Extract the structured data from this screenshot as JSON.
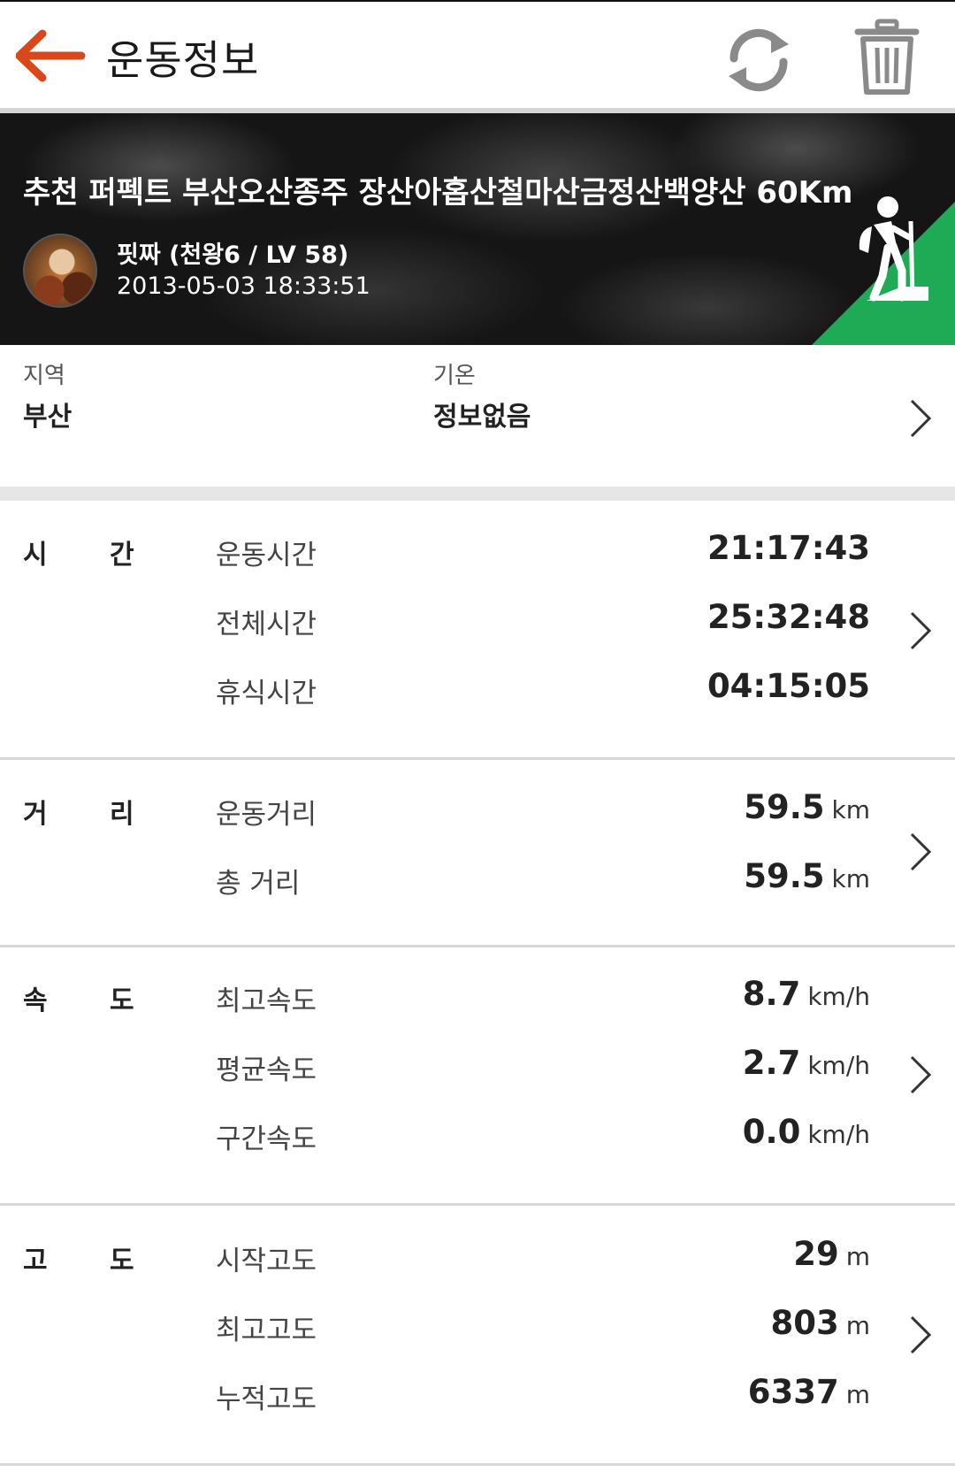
{
  "header": {
    "title": "운동정보",
    "back_icon": "arrow-left-icon",
    "refresh_icon": "refresh-icon",
    "delete_icon": "trash-icon",
    "accent": "#d9481b"
  },
  "banner": {
    "title": "추천 퍼펙트 부산오산종주 장산아홉산철마산금정산백양산 60Km",
    "user": "핏짜 (천왕6 / LV 58)",
    "datetime": "2013-05-03 18:33:51",
    "activity_icon": "hiker-icon",
    "activity_color": "#1faa55"
  },
  "info": {
    "region_label": "지역",
    "region_value": "부산",
    "temp_label": "기온",
    "temp_value": "정보없음"
  },
  "sections": {
    "time": {
      "label_a": "시",
      "label_b": "간",
      "rows": [
        {
          "label": "운동시간",
          "value": "21:17:43",
          "unit": ""
        },
        {
          "label": "전체시간",
          "value": "25:32:48",
          "unit": ""
        },
        {
          "label": "휴식시간",
          "value": "04:15:05",
          "unit": ""
        }
      ]
    },
    "distance": {
      "label_a": "거",
      "label_b": "리",
      "rows": [
        {
          "label": "운동거리",
          "value": "59.5",
          "unit": "km"
        },
        {
          "label": "총 거리",
          "value": "59.5",
          "unit": "km"
        }
      ]
    },
    "speed": {
      "label_a": "속",
      "label_b": "도",
      "rows": [
        {
          "label": "최고속도",
          "value": "8.7",
          "unit": "km/h"
        },
        {
          "label": "평균속도",
          "value": "2.7",
          "unit": "km/h"
        },
        {
          "label": "구간속도",
          "value": "0.0",
          "unit": "km/h"
        }
      ]
    },
    "altitude": {
      "label_a": "고",
      "label_b": "도",
      "rows": [
        {
          "label": "시작고도",
          "value": "29",
          "unit": "m"
        },
        {
          "label": "최고고도",
          "value": "803",
          "unit": "m"
        },
        {
          "label": "누적고도",
          "value": "6337",
          "unit": "m"
        }
      ]
    }
  }
}
